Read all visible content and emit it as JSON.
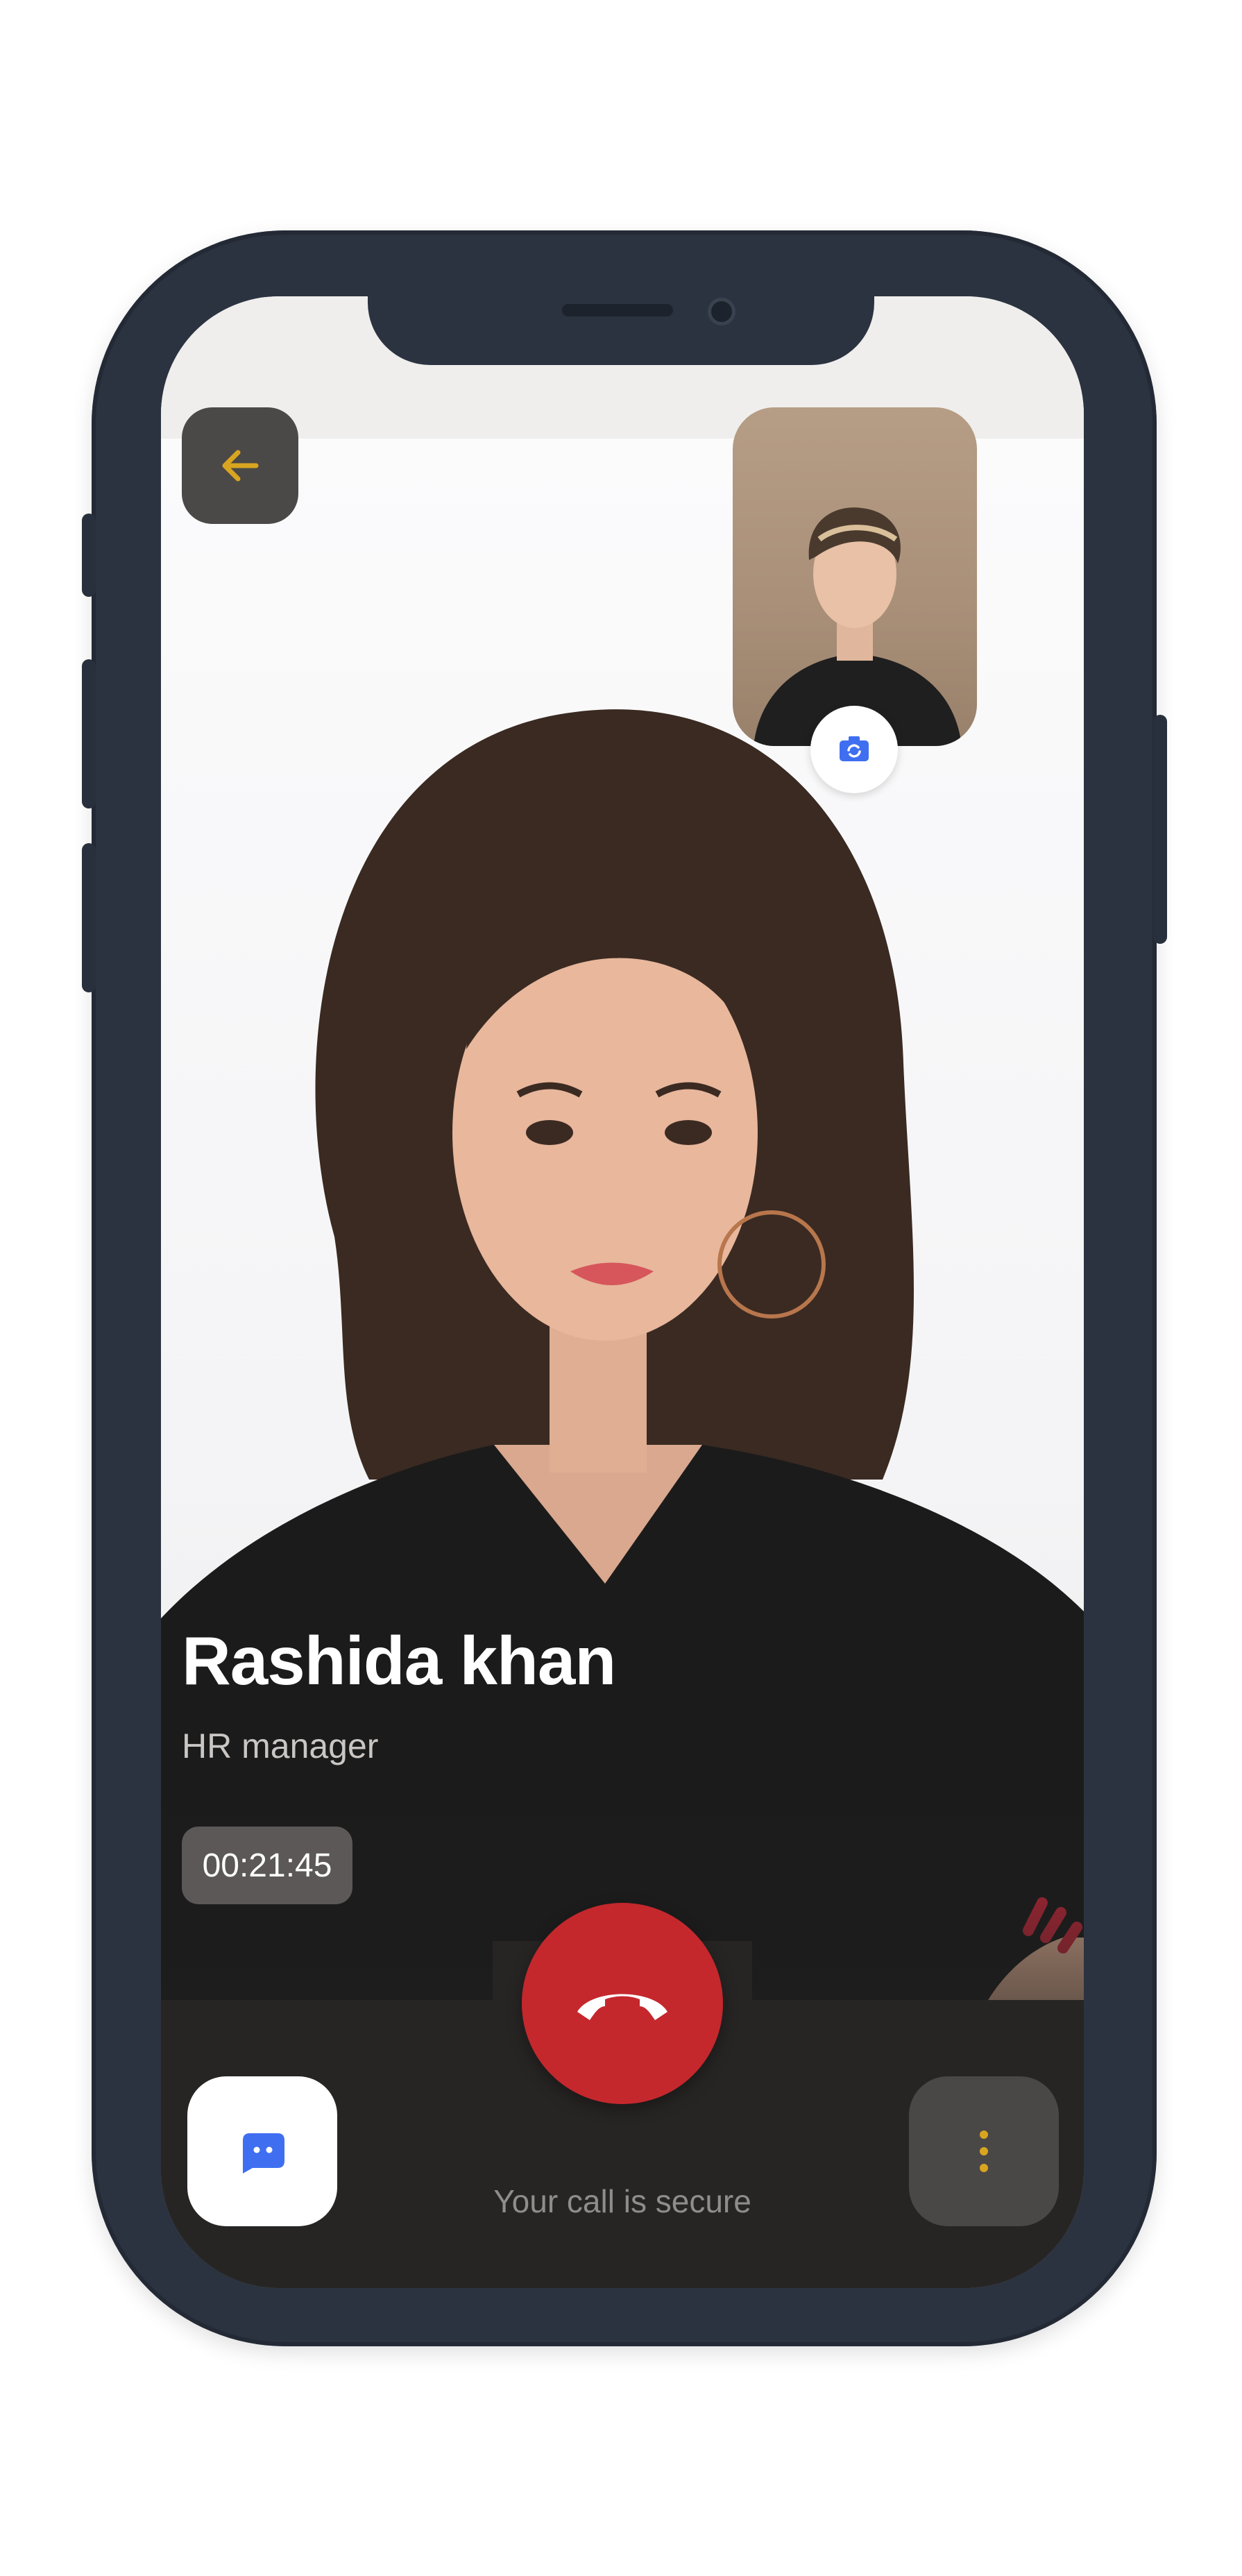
{
  "call": {
    "caller_name": "Rashida khan",
    "caller_role": "HR manager",
    "duration": "00:21:45",
    "secure_note": "Your call is secure"
  },
  "icons": {
    "back": "arrow-left-icon",
    "camera_switch": "camera-switch-icon",
    "end_call": "phone-hangup-icon",
    "chat": "chat-bubble-icon",
    "more": "more-vertical-icon"
  },
  "colors": {
    "accent_yellow": "#d9a520",
    "end_call_red": "#c4282d",
    "chat_blue": "#3f6ff0",
    "phone_frame": "#2b3340",
    "bottom_bar": "#272524"
  }
}
